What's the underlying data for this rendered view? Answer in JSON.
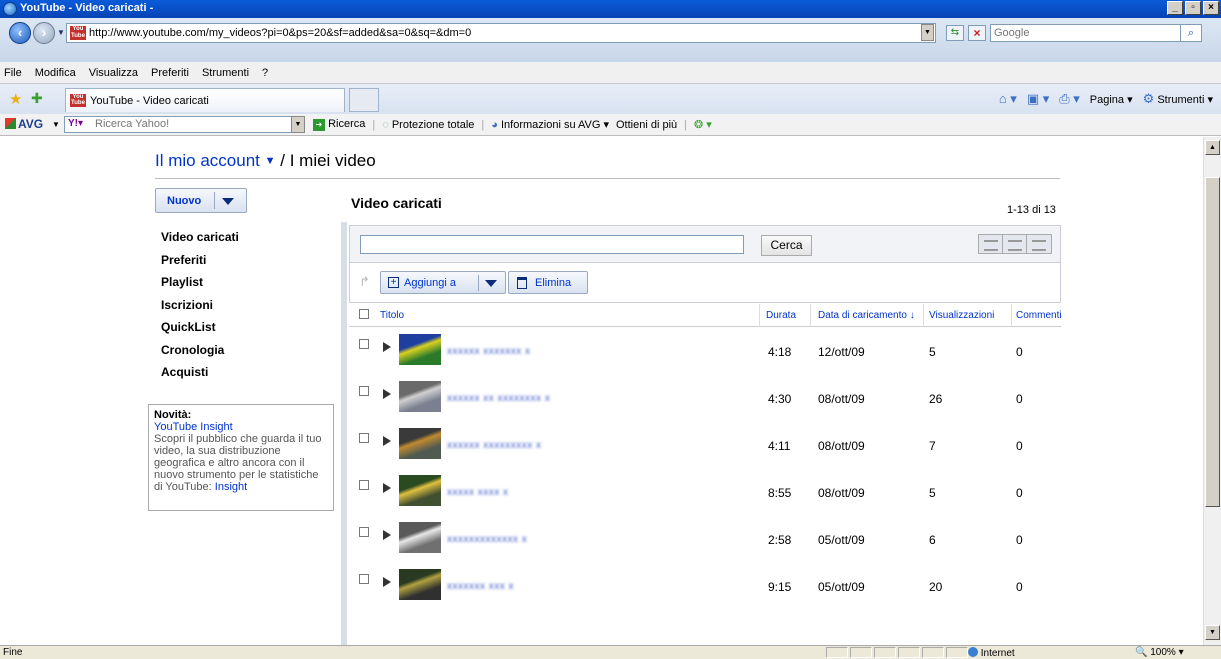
{
  "browser": {
    "window_title": "YouTube - Video caricati -",
    "url": "http://www.youtube.com/my_videos?pi=0&ps=20&sf=added&sa=0&sq=&dm=0",
    "search_placeholder": "Google",
    "favicon_text": "You Tube",
    "menu": [
      "File",
      "Modifica",
      "Visualizza",
      "Preferiti",
      "Strumenti",
      "?"
    ],
    "tab_title": "YouTube - Video caricati",
    "command_bar": {
      "page": "Pagina",
      "tools": "Strumenti"
    },
    "avg": {
      "logo": "AVG",
      "search_placeholder": "Ricerca Yahoo!",
      "search_label": "Ricerca",
      "protection": "Protezione totale",
      "info": "Informazioni su AVG",
      "more": "Ottieni di più"
    },
    "status": {
      "text": "Fine",
      "zone": "Internet",
      "zoom": "100%"
    }
  },
  "page": {
    "breadcrumb": {
      "account": "Il mio account",
      "separator": "/",
      "current": "I miei video"
    },
    "new_button": "Nuovo",
    "section_title": "Video caricati",
    "count": "1-13 di 13",
    "sidebar": {
      "items": [
        "Video caricati",
        "Preferiti",
        "Playlist",
        "Iscrizioni",
        "QuickList",
        "Cronologia",
        "Acquisti"
      ]
    },
    "news": {
      "heading": "Novità:",
      "link": "YouTube Insight",
      "text": "Scopri il pubblico che guarda il tuo video, la sua distribuzione geografica e altro ancora con il nuovo strumento per le statistiche di YouTube:",
      "text_link": "Insight"
    },
    "filter": {
      "search_button": "Cerca"
    },
    "actions": {
      "add_to": "Aggiungi a",
      "delete": "Elimina"
    },
    "columns": {
      "title": "Titolo",
      "duration": "Durata",
      "upload_date": "Data di caricamento ↓",
      "views": "Visualizzazioni",
      "comments": "Commenti"
    },
    "rows": [
      {
        "title": "xxxxxx xxxxxxx x",
        "duration": "4:18",
        "date": "12/ott/09",
        "views": "5",
        "comments": "0"
      },
      {
        "title": "xxxxxx xx xxxxxxxx x",
        "duration": "4:30",
        "date": "08/ott/09",
        "views": "26",
        "comments": "0"
      },
      {
        "title": "xxxxxx xxxxxxxxx x",
        "duration": "4:11",
        "date": "08/ott/09",
        "views": "7",
        "comments": "0"
      },
      {
        "title": "xxxxx xxxx x",
        "duration": "8:55",
        "date": "08/ott/09",
        "views": "5",
        "comments": "0"
      },
      {
        "title": "xxxxxxxxxxxxx x",
        "duration": "2:58",
        "date": "05/ott/09",
        "views": "6",
        "comments": "0"
      },
      {
        "title": "xxxxxxx xxx x",
        "duration": "9:15",
        "date": "05/ott/09",
        "views": "20",
        "comments": "0"
      }
    ],
    "colors": {
      "link": "#0033cc",
      "button_border": "#9aa9c2"
    }
  }
}
